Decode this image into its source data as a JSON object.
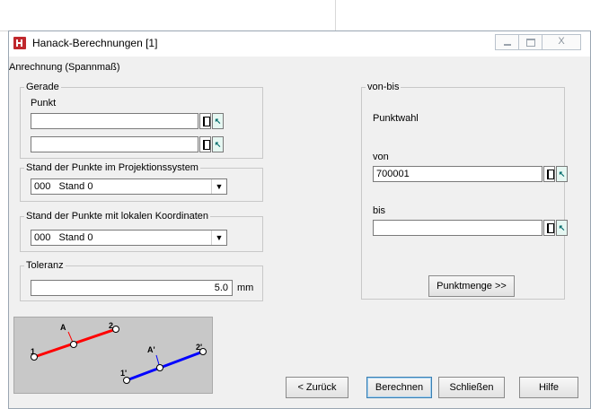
{
  "window": {
    "title": "Hanack-Berechnungen [1]",
    "close_symbol": "X"
  },
  "section": {
    "title": "Anrechnung (Spannmaß)"
  },
  "gerade": {
    "legend": "Gerade",
    "punkt_label": "Punkt",
    "punkt1_value": "",
    "punkt2_value": ""
  },
  "projektion": {
    "legend": "Stand der Punkte im Projektionssystem",
    "code": "000",
    "value": "Stand 0"
  },
  "lokal": {
    "legend": "Stand der Punkte mit lokalen Koordinaten",
    "code": "000",
    "value": "Stand 0"
  },
  "toleranz": {
    "legend": "Toleranz",
    "value": "5.0",
    "unit": "mm"
  },
  "vonbis": {
    "legend": "von-bis",
    "punktwahl": "Punktwahl",
    "von_label": "von",
    "von_value": "700001",
    "bis_label": "bis",
    "bis_value": "",
    "punktmenge_button": "Punktmenge >>"
  },
  "diagram": {
    "labels": {
      "a": "A",
      "a_prime": "A'",
      "p1": "1",
      "p2": "2",
      "p1_prime": "1'",
      "p2_prime": "2'"
    },
    "colors": {
      "red": "#ff0000",
      "blue": "#0000ff"
    }
  },
  "buttons": {
    "back": "< Zurück",
    "calc": "Berechnen",
    "close": "Schließen",
    "help": "Hilfe"
  }
}
